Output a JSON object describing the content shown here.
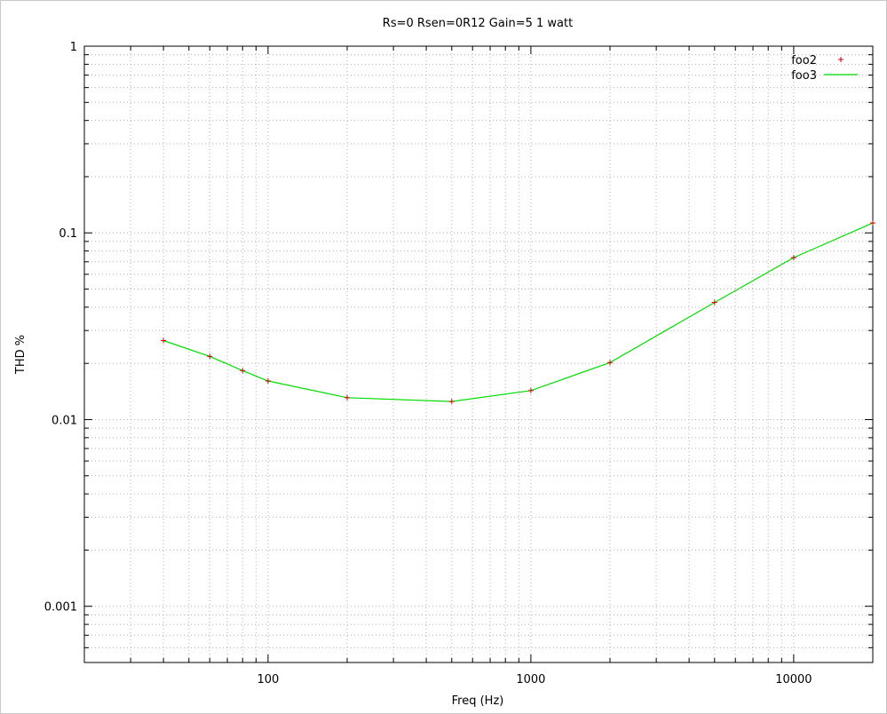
{
  "chart_data": {
    "type": "line",
    "title": "Rs=0  Rsen=0R12 Gain=5 1 watt",
    "xlabel": "Freq (Hz)",
    "ylabel": "THD %",
    "x_scale": "log",
    "y_scale": "log",
    "xlim": [
      20,
      20000
    ],
    "ylim": [
      0.0005,
      1
    ],
    "grid": true,
    "legend_position": "top-right",
    "x_tick_labels": [
      {
        "value": 100,
        "label": "100"
      },
      {
        "value": 1000,
        "label": "1000"
      },
      {
        "value": 10000,
        "label": "10000"
      }
    ],
    "y_tick_labels": [
      {
        "value": 1,
        "label": "1"
      },
      {
        "value": 0.1,
        "label": "0.1"
      },
      {
        "value": 0.01,
        "label": "0.01"
      },
      {
        "value": 0.001,
        "label": "0.001"
      }
    ],
    "x": [
      40,
      60,
      80,
      100,
      200,
      500,
      1000,
      2000,
      5000,
      10000,
      20000
    ],
    "series": [
      {
        "name": "foo2",
        "style": "points",
        "color": "#cc0000",
        "values": [
          0.0265,
          0.0218,
          0.0183,
          0.0161,
          0.0131,
          0.0125,
          0.0143,
          0.0202,
          0.0424,
          0.0737,
          0.113
        ]
      },
      {
        "name": "foo3",
        "style": "line",
        "color": "#00dd00",
        "values": [
          0.0265,
          0.0218,
          0.0183,
          0.0161,
          0.0131,
          0.0125,
          0.0143,
          0.0202,
          0.0424,
          0.0737,
          0.113
        ]
      }
    ]
  }
}
